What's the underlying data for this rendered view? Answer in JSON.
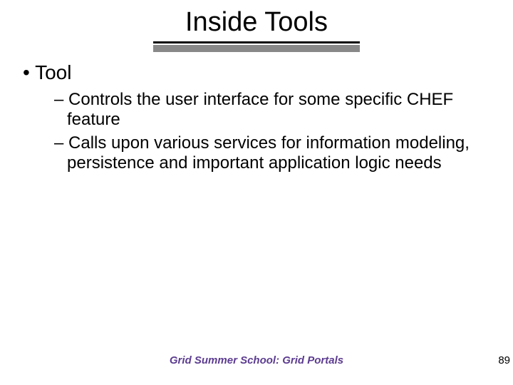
{
  "title": "Inside Tools",
  "bullet1": "Tool",
  "sub": [
    "Controls the user interface for some specific CHEF feature",
    "Calls upon various services for information modeling, persistence and important application logic needs"
  ],
  "footer": "Grid Summer School: Grid Portals",
  "page": "89"
}
